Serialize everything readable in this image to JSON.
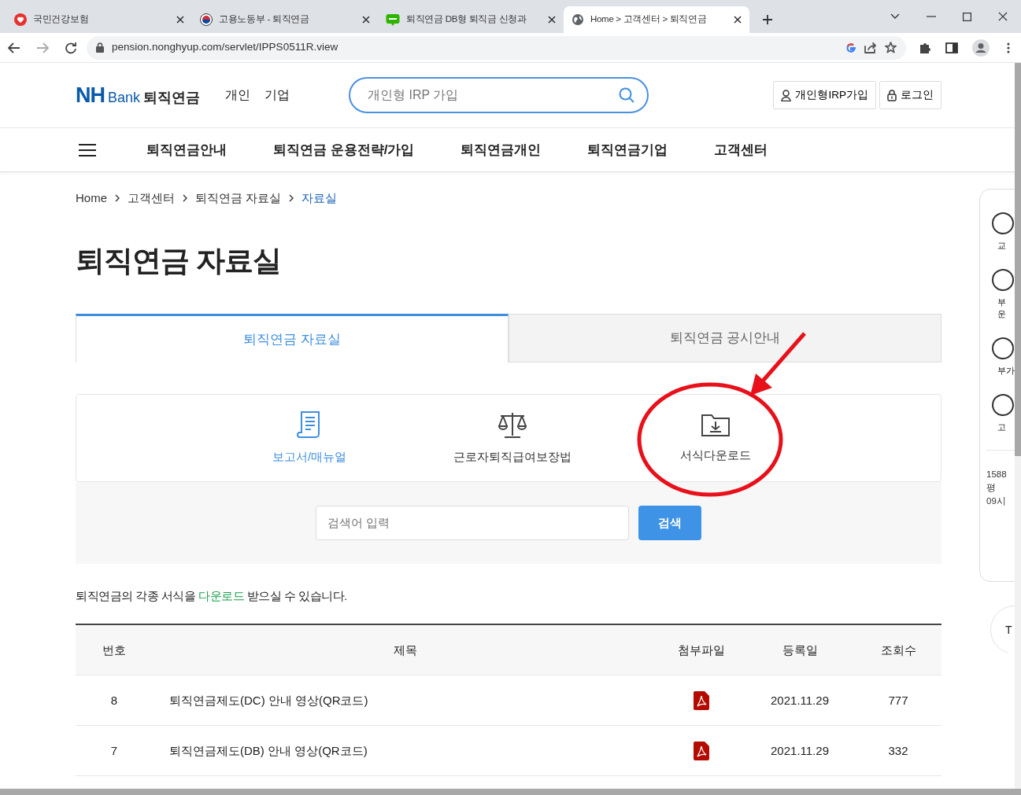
{
  "browser": {
    "tabs": [
      {
        "title": "국민건강보험",
        "selected": false,
        "kind": "heart"
      },
      {
        "title": "고용노동부 - 퇴직연금",
        "selected": false,
        "kind": "emblem"
      },
      {
        "title": "퇴직연금 DB형 퇴직금 신청과",
        "selected": false,
        "kind": "blog"
      },
      {
        "title": "Home > 고객센터 > 퇴직연금",
        "selected": true,
        "kind": "globe"
      }
    ],
    "url": "pension.nonghyup.com/servlet/IPPS0511R.view"
  },
  "header": {
    "logo": {
      "mark": "NH",
      "bank": "Bank",
      "product": "퇴직연금"
    },
    "segments": [
      "개인",
      "기업"
    ],
    "search_placeholder": "개인형 IRP 가입",
    "buttons": [
      {
        "label": "개인형IRP가입",
        "kind": "user"
      },
      {
        "label": "로그인",
        "kind": "lock"
      }
    ]
  },
  "nav": [
    "퇴직연금안내",
    "퇴직연금 운용전략/가입",
    "퇴직연금개인",
    "퇴직연금기업",
    "고객센터"
  ],
  "breadcrumb": [
    {
      "label": "Home",
      "selected": false
    },
    {
      "label": "고객센터",
      "selected": false
    },
    {
      "label": "퇴직연금 자료실",
      "selected": false
    },
    {
      "label": "자료실",
      "selected": true
    }
  ],
  "title": "퇴직연금 자료실",
  "tabs": [
    {
      "label": "퇴직연금 자료실",
      "selected": true
    },
    {
      "label": "퇴직연금 공시안내",
      "selected": false
    }
  ],
  "categories": [
    {
      "label": "보고서/매뉴얼",
      "selected": true,
      "kind": "document"
    },
    {
      "label": "근로자퇴직급여보장법",
      "selected": false,
      "kind": "scale"
    },
    {
      "label": "서식다운로드",
      "selected": false,
      "kind": "folder"
    }
  ],
  "search": {
    "placeholder": "검색어 입력",
    "button": "검색"
  },
  "notice": {
    "before": "퇴직연금의 각종 서식을 ",
    "highlight": "다운로드",
    "after": " 받으실 수 있습니다."
  },
  "table": {
    "columns": [
      "번호",
      "제목",
      "첨부파일",
      "등록일",
      "조회수"
    ],
    "rows": [
      {
        "number": "8",
        "title": "퇴직연금제도(DC) 안내 영상(QR코드)",
        "date": "2021.11.29",
        "views": "777"
      },
      {
        "number": "7",
        "title": "퇴직연금제도(DB) 안내 영상(QR코드)",
        "date": "2021.11.29",
        "views": "332"
      }
    ]
  },
  "quick_menu": {
    "items": [
      {
        "lines": [
          "교"
        ]
      },
      {
        "lines": [
          "부",
          "운"
        ]
      },
      {
        "lines": [
          "부가"
        ]
      },
      {
        "lines": [
          "고"
        ]
      }
    ],
    "contact": [
      "1588",
      "평",
      "09시"
    ],
    "top_button": "T"
  }
}
